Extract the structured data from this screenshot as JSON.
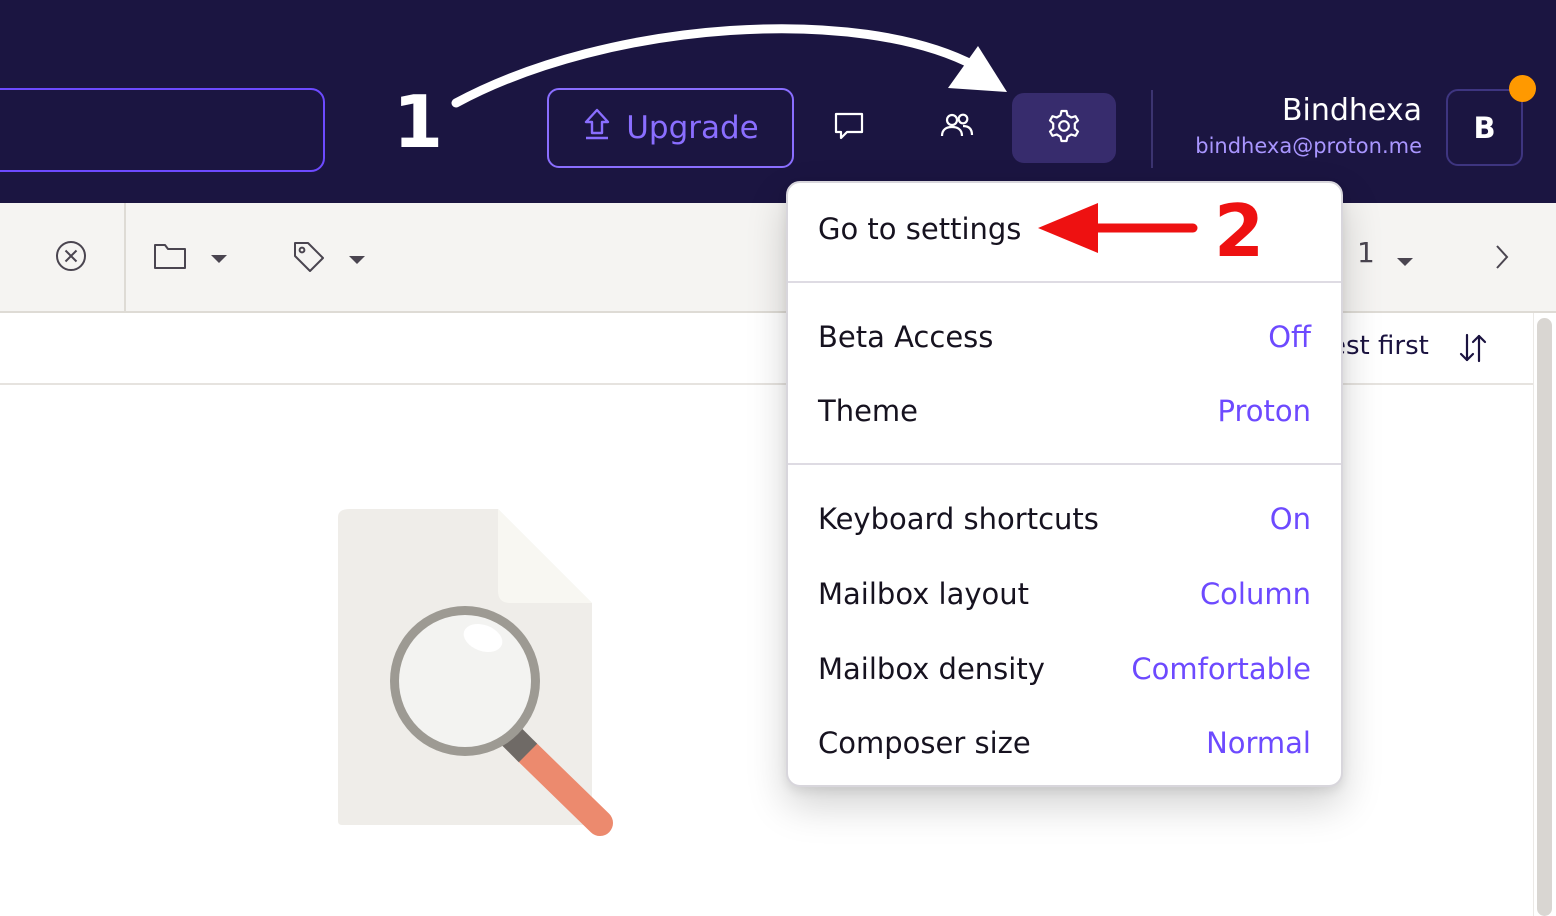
{
  "header": {
    "upgrade_label": "Upgrade",
    "user_name": "Bindhexa",
    "user_email": "bindhexa@proton.me",
    "avatar_initial": "B",
    "icons": [
      "upgrade-icon",
      "chat-icon",
      "people-icon",
      "gear-icon"
    ],
    "colors": {
      "background": "#1b1541",
      "accent": "#6d4aff",
      "notification": "#ff9900"
    }
  },
  "toolbar": {
    "page_number": "1",
    "icons": [
      "close-circle-icon",
      "folder-icon",
      "tag-icon",
      "chevron-down-icon",
      "chevron-right-icon"
    ]
  },
  "list": {
    "sort_label": "est first"
  },
  "menu": {
    "go_to_settings": "Go to settings",
    "items": [
      {
        "label": "Beta Access",
        "value": "Off"
      },
      {
        "label": "Theme",
        "value": "Proton"
      },
      {
        "label": "Keyboard shortcuts",
        "value": "On"
      },
      {
        "label": "Mailbox layout",
        "value": "Column"
      },
      {
        "label": "Mailbox density",
        "value": "Comfortable"
      },
      {
        "label": "Composer size",
        "value": "Normal"
      }
    ],
    "value_color": "#6d4aff"
  },
  "annotations": {
    "step1": "1",
    "step2": "2",
    "step1_color": "#ffffff",
    "step2_color": "#ee1111"
  }
}
